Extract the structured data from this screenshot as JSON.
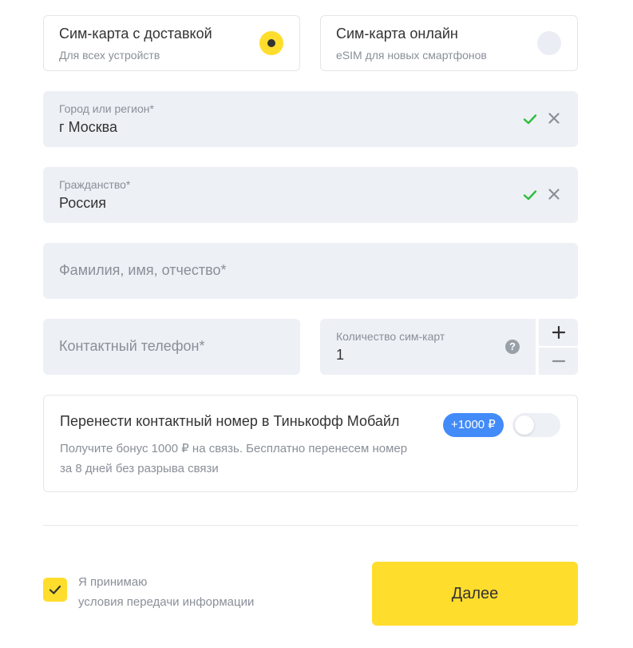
{
  "sim_options": [
    {
      "title": "Сим-карта с доставкой",
      "subtitle": "Для всех устройств",
      "selected": true
    },
    {
      "title": "Сим-карта онлайн",
      "subtitle": "eSIM для новых смартфонов",
      "selected": false
    }
  ],
  "fields": {
    "city": {
      "label": "Город или регион*",
      "value": "г Москва"
    },
    "citizenship": {
      "label": "Гражданство*",
      "value": "Россия"
    },
    "full_name": {
      "placeholder": "Фамилия, имя, отчество*"
    },
    "phone": {
      "placeholder": "Контактный телефон*"
    },
    "sim_count": {
      "label": "Количество сим-карт",
      "value": "1"
    }
  },
  "stepper": {
    "plus": "+",
    "minus": "−"
  },
  "help_glyph": "?",
  "transfer": {
    "title": "Перенести контактный номер в Тинькофф Мобайл",
    "description": "Получите бонус 1000 ₽ на связь. Бесплатно перенесем номер за 8 дней без разрыва связи",
    "bonus": "+1000 ₽",
    "toggle_on": false
  },
  "consent": {
    "line1": "Я принимаю",
    "line2": "условия передачи информации",
    "checked": true
  },
  "next_button": "Далее",
  "colors": {
    "accent": "#ffdd2d",
    "field_bg": "#edf0f5",
    "check_green": "#2ebd3c",
    "badge_blue": "#428bf9",
    "muted_text": "#8a8f98"
  }
}
